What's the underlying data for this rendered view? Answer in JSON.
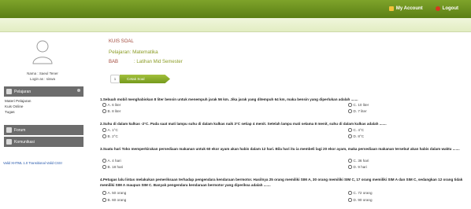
{
  "topbar": {
    "account_label": "My Account",
    "logout_label": "Logout"
  },
  "user": {
    "name": "Nama : Saeul Tener",
    "login": "Login as : siswa"
  },
  "sidebar": {
    "pelajaran_label": "Pelajaran",
    "items": [
      "Materi Pelajaran",
      "Kuis Online",
      "Tugas"
    ],
    "forum_label": "Forum",
    "komunikasi_label": "Komunikasi",
    "validator": "Valid XHTML 1.0 Transitional Valid CSS!"
  },
  "quiz": {
    "title": "KUIS SOAL",
    "subject": "Pelajaran: Matematika",
    "bab_label": "BAB",
    "bab_value": ": Latihan Mid Semester",
    "step": "1",
    "print_button": "Cetak Soal"
  },
  "questions": [
    {
      "text": "1.Sebuah mobil menghabiskan 8 liter bensin untuk menempuh jarak 56 km. Jika jarak yang ditempuh 64 km, maka bensin yang diperlukan adalah .......",
      "options": [
        "A. 6 liter",
        "C. 10 liter",
        "B. 8 liter",
        "D. 7 liter"
      ]
    },
    {
      "text": "2.Suhu di dalam kulkas -2°C. Pada saat mati lampu suhu di dalam kulkas naik 3°C setiap 4 menit. Setelah lampu mati selama 8 menit, suhu di dalam kulkas adalah .......",
      "options": [
        "A. 1°C",
        "C. 4°C",
        "B. 2°C",
        "D. 8°C"
      ]
    },
    {
      "text": "3.Suatu hari Toko memperkirakan persediaan makanan untuk 60 ekor ayam akan habis dalam 12 hari. Bila hari itu ia membeli lagi 20 ekor ayam, maka persediaan makanan tersebut akan habis dalam waktu .......",
      "options": [
        "A. 4 hari",
        "C. 36 hari",
        "B. 18 hari",
        "D. 9 hari"
      ]
    },
    {
      "text": "4.Petugas lalu lintas melakukan pemeriksaan terhadap pengendara kendaraan bermotor. Hasilnya 25 orang memiliki SIM A, 30 orang memiliki SIM C, 17 orang memiliki SIM A dan SIM C, sedangkan 12 orang tidak memiliki SIM A maupun SIM C. Banyak pengendara kendaraan bermotor yang diperiksa adalah .......",
      "options": [
        "A. 50 orang",
        "C. 72 orang",
        "B. 60 orang",
        "D. 90 orang"
      ]
    }
  ],
  "colors": {
    "brand_green": "#6a8e1f",
    "accent_red": "#a24a3c",
    "subject_green": "#8b9c25"
  }
}
